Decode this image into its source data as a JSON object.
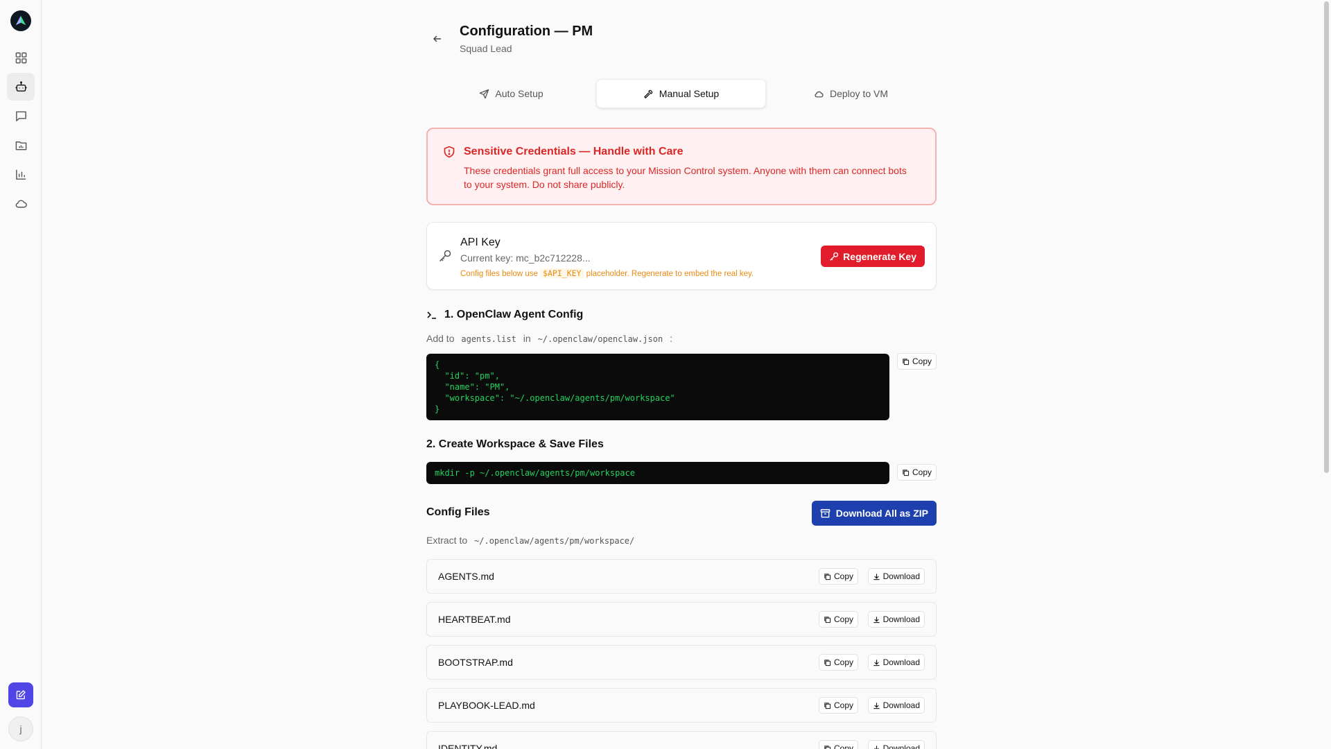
{
  "header": {
    "title": "Configuration — PM",
    "subtitle": "Squad Lead"
  },
  "tabs": [
    {
      "label": "Auto Setup",
      "icon": "send-icon"
    },
    {
      "label": "Manual Setup",
      "icon": "wrench-icon",
      "active": true
    },
    {
      "label": "Deploy to VM",
      "icon": "cloud-icon"
    }
  ],
  "alert": {
    "title": "Sensitive Credentials — Handle with Care",
    "text": "These credentials grant full access to your Mission Control system. Anyone with them can connect bots to your system. Do not share publicly."
  },
  "api_key": {
    "title": "API Key",
    "current": "Current key: mc_b2c712228...",
    "note_prefix": "Config files below use",
    "note_code": "$API_KEY",
    "note_suffix": "placeholder. Regenerate to embed the real key.",
    "regenerate_label": "Regenerate Key"
  },
  "section1": {
    "title": "1. OpenClaw Agent Config",
    "sub_prefix": "Add to",
    "sub_code1": "agents.list",
    "sub_mid": "in",
    "sub_code2": "~/.openclaw/openclaw.json",
    "sub_suffix": ":",
    "code_lines": [
      "{",
      "  \"id\": \"pm\",",
      "  \"name\": \"PM\",",
      "  \"workspace\": \"~/.openclaw/agents/pm/workspace\"",
      "}"
    ],
    "copy_label": "Copy"
  },
  "section2": {
    "title": "2. Create Workspace & Save Files",
    "command": "mkdir -p ~/.openclaw/agents/pm/workspace",
    "copy_label": "Copy"
  },
  "config_files": {
    "title": "Config Files",
    "zip_label": "Download All as ZIP",
    "extract_prefix": "Extract to",
    "extract_path": "~/.openclaw/agents/pm/workspace/",
    "copy_label": "Copy",
    "download_label": "Download",
    "files": [
      "AGENTS.md",
      "HEARTBEAT.md",
      "BOOTSTRAP.md",
      "PLAYBOOK-LEAD.md",
      "IDENTITY.md"
    ]
  },
  "user": {
    "initial": "j"
  },
  "colors": {
    "accent": "#4f46e5",
    "danger": "#dc2626",
    "regenerate": "#e11d2c",
    "zip_button": "#1e40af",
    "code_text": "#22d35f",
    "warning": "#ea8a10"
  }
}
